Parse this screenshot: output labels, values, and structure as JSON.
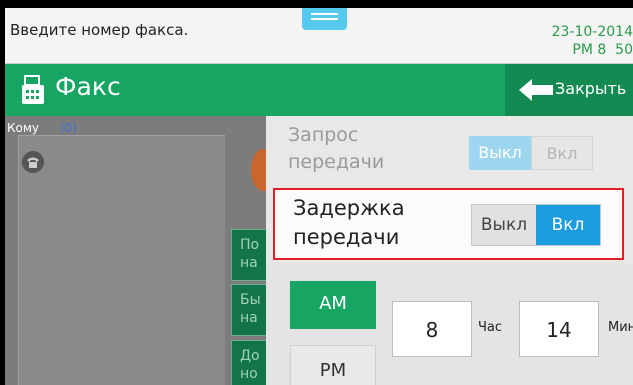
{
  "status": {
    "message": "Введите номер факса.",
    "date": "23-10-2014",
    "time": "PM 8  50"
  },
  "header": {
    "title": "Факс",
    "close_label": "Закрыть"
  },
  "recipient": {
    "label": "Кому",
    "count": "(0)"
  },
  "side_buttons": [
    {
      "line1": "По",
      "line2": "на"
    },
    {
      "line1": "Бы",
      "line2": "на"
    },
    {
      "line1": "До",
      "line2": "но"
    }
  ],
  "settings": {
    "send_request": {
      "label_line1": "Запрос",
      "label_line2": "передачи",
      "off": "Выкл",
      "on": "Вкл",
      "selected": "off"
    },
    "send_delay": {
      "label_line1": "Задержка",
      "label_line2": "передачи",
      "off": "Выкл",
      "on": "Вкл",
      "selected": "on"
    },
    "am_label": "AM",
    "pm_label": "PM",
    "period_selected": "AM",
    "hour": "8",
    "hour_unit": "Час",
    "minute": "14",
    "minute_unit": "Мин."
  },
  "colors": {
    "header_green": "#17a563",
    "toggle_active_blue": "#1b9be0",
    "highlight_red": "#e01f26",
    "status_text_green": "#2a9a49"
  }
}
